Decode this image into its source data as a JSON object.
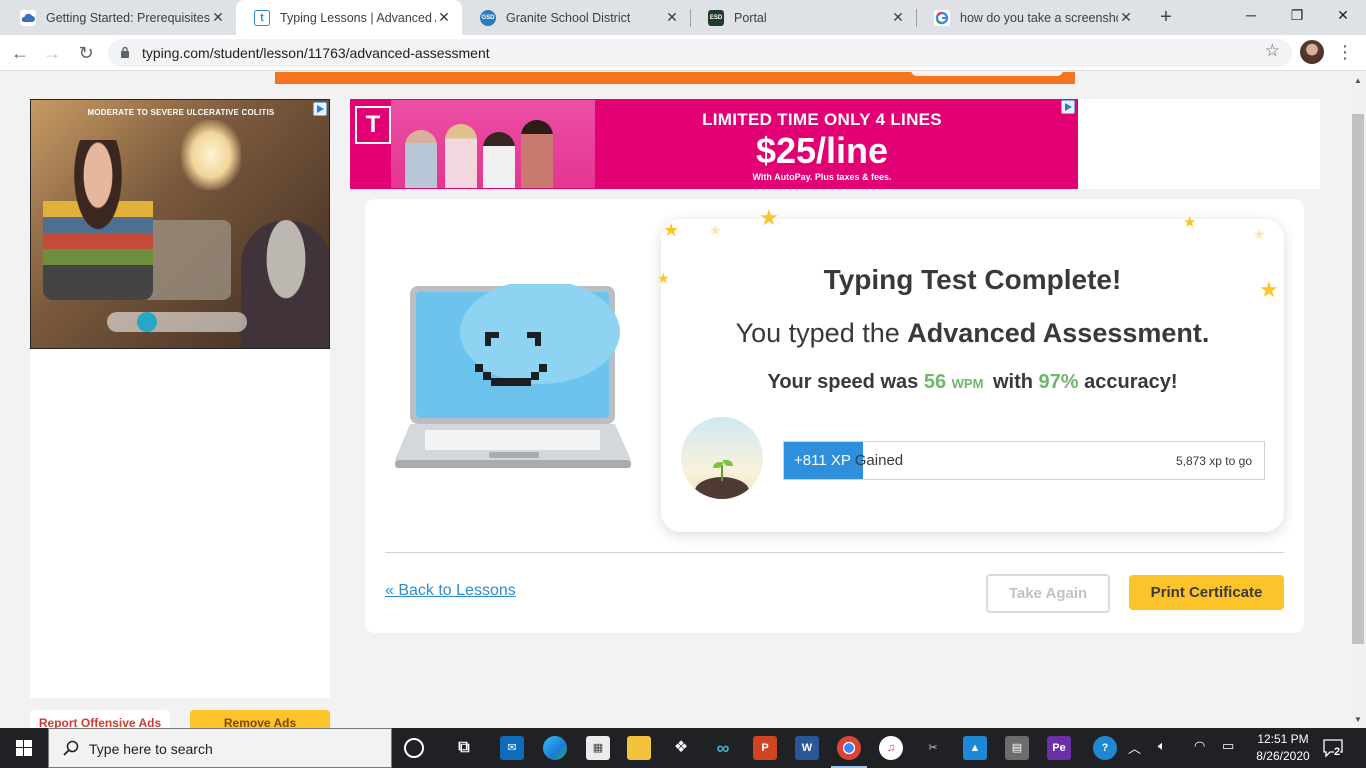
{
  "browser": {
    "tabs": [
      {
        "title": "Getting Started: Prerequisites",
        "favicon": "cloud-favicon-icon"
      },
      {
        "title": "Typing Lessons | Advanced Ass",
        "favicon": "typing-favicon-icon"
      },
      {
        "title": "Granite School District",
        "favicon": "granite-favicon-icon"
      },
      {
        "title": "Portal",
        "favicon": "esd-favicon-icon"
      },
      {
        "title": "how do you take a screenshot",
        "favicon": "google-favicon-icon"
      }
    ],
    "tab_close": "✕",
    "new_tab": "+",
    "url": "typing.com/student/lesson/11763/advanced-assessment",
    "favicon_labels": {
      "typing": "t",
      "granite": "GSD",
      "esd": "ESD"
    }
  },
  "ads": {
    "left_caption": "MODERATE TO SEVERE ULCERATIVE COLITIS",
    "top_logo": "T",
    "top_headline": "LIMITED TIME ONLY 4 LINES",
    "top_price": "$25/line",
    "top_fine": "With AutoPay. Plus taxes & fees.",
    "report_label": "Report Offensive Ads",
    "remove_label": "Remove Ads"
  },
  "result": {
    "title": "Typing Test Complete!",
    "typed_prefix": "You typed the ",
    "lesson_name": "Advanced Assessment.",
    "speed_prefix": "Your speed was ",
    "wpm_value": "56",
    "wpm_unit": "WPM",
    "speed_mid": " with ",
    "accuracy": "97%",
    "speed_suffix": " accuracy!",
    "xp_gained_value": "+811 XP",
    "xp_gained_text": " Gained",
    "xp_to_go": "5,873 xp to go",
    "xp_progress": 0.165
  },
  "actions": {
    "back_link": "« Back to Lessons",
    "take_again": "Take Again",
    "print_certificate": "Print Certificate"
  },
  "taskbar": {
    "search_placeholder": "Type here to search",
    "time": "12:51 PM",
    "date": "8/26/2020",
    "notifications": "2",
    "app_labels": {
      "powerpoint": "P",
      "word": "W",
      "pe": "Pe"
    }
  },
  "colors": {
    "accent_yellow": "#fcc32a",
    "xp_blue": "#2e90dc",
    "stat_green": "#6fb56a",
    "link_blue": "#2e8ad1",
    "tmobile_magenta": "#e20074"
  }
}
